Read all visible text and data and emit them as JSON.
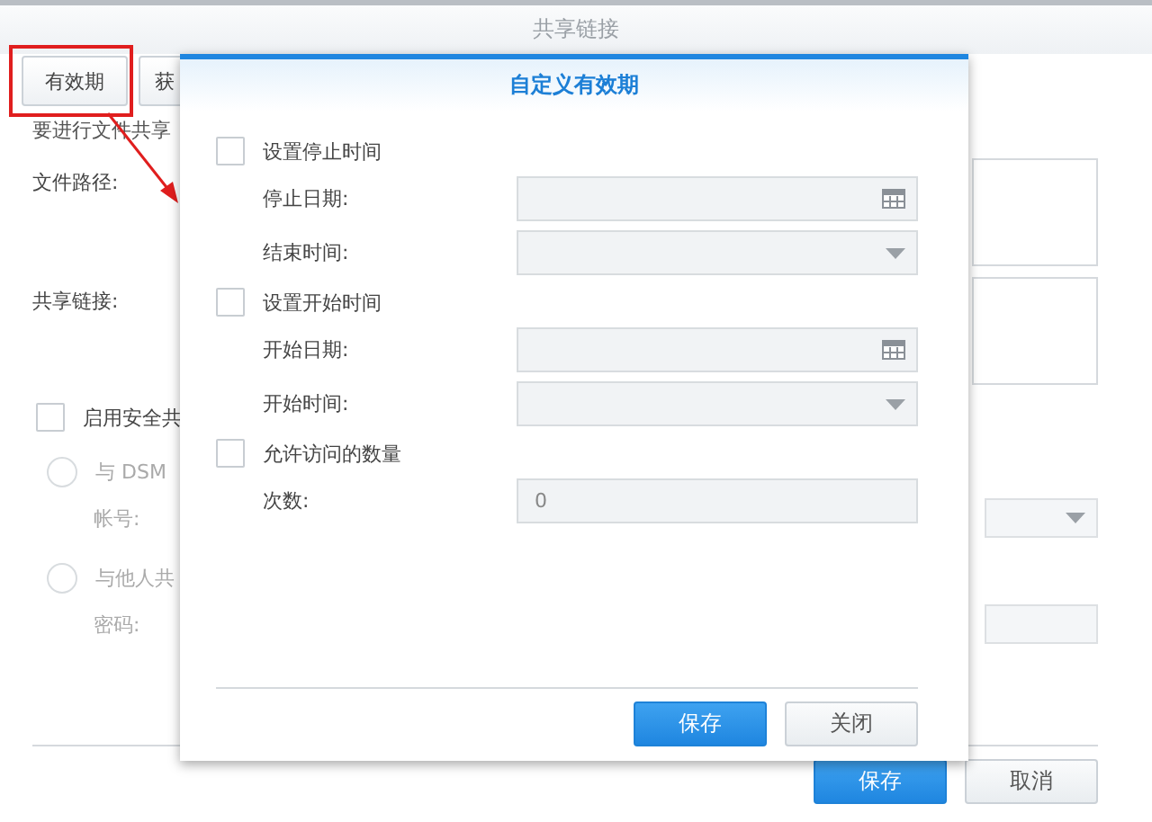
{
  "window": {
    "title": "共享链接"
  },
  "tabs": [
    {
      "label": "有效期",
      "annotated": true
    },
    {
      "label": "获",
      "annotated": false
    }
  ],
  "intro": "要进行文件共享",
  "fields": [
    {
      "label": "文件路径:",
      "kind": "textarea"
    },
    {
      "label": "共享链接:",
      "kind": "textarea"
    }
  ],
  "secure_share": {
    "label": "启用安全共",
    "checked": false
  },
  "share_options": [
    {
      "label": "与 DSM",
      "selected": false,
      "disabled": true,
      "field": {
        "label": "帐号:",
        "kind": "dropdown"
      }
    },
    {
      "label": "与他人共",
      "selected": false,
      "disabled": true,
      "field": {
        "label": "密码:",
        "kind": "text"
      }
    }
  ],
  "buttons": [
    {
      "label": "保存",
      "kind": "primary"
    },
    {
      "label": "取消",
      "kind": "secondary"
    }
  ],
  "dialog": {
    "title": "自定义有效期",
    "sections": [
      {
        "label": "设置停止时间",
        "checked": false,
        "fields": [
          {
            "label": "停止日期:",
            "kind": "date",
            "disabled": true
          },
          {
            "label": "结束时间:",
            "kind": "time",
            "disabled": true
          }
        ]
      },
      {
        "label": "设置开始时间",
        "checked": false,
        "fields": [
          {
            "label": "开始日期:",
            "kind": "date",
            "disabled": true
          },
          {
            "label": "开始时间:",
            "kind": "time",
            "disabled": true
          }
        ]
      },
      {
        "label": "允许访问的数量",
        "checked": false,
        "fields": [
          {
            "label": "次数:",
            "kind": "number",
            "value": "0",
            "disabled": true
          }
        ]
      }
    ],
    "buttons": [
      {
        "label": "保存",
        "kind": "primary"
      },
      {
        "label": "关闭",
        "kind": "secondary"
      }
    ]
  }
}
